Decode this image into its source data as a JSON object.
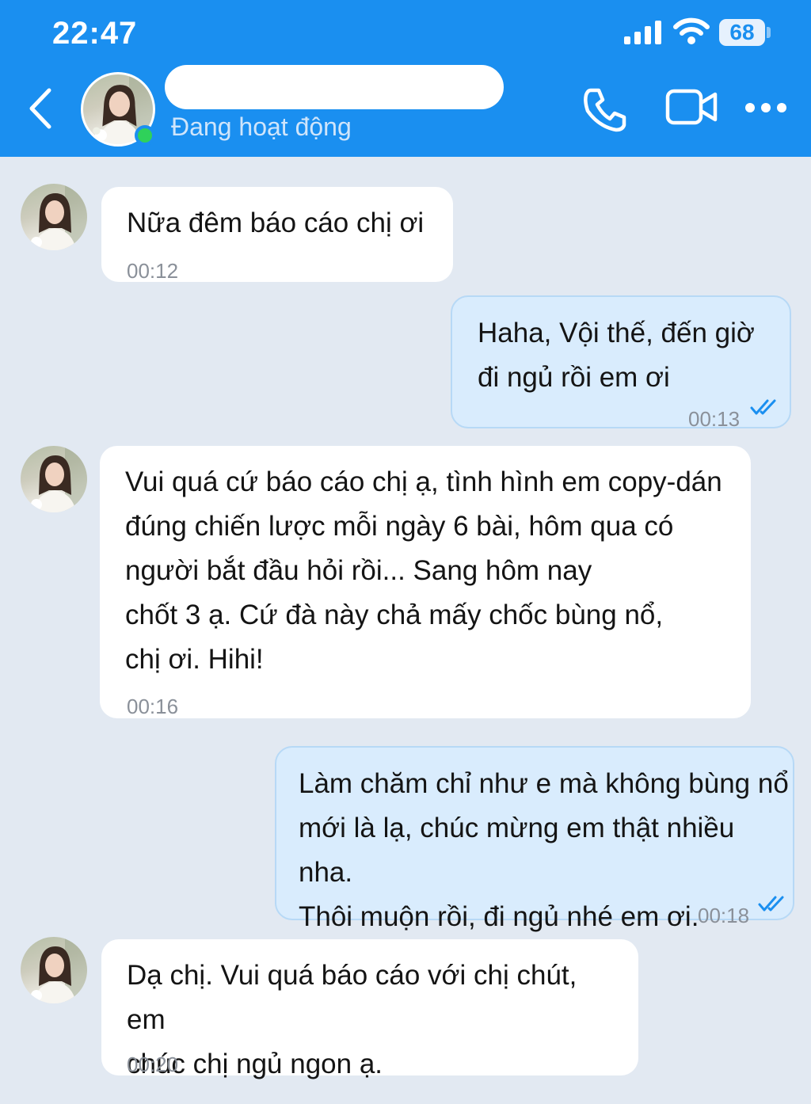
{
  "status_bar": {
    "time": "22:47",
    "battery": "68"
  },
  "header": {
    "contact_name": "",
    "contact_status": "Đang hoạt động",
    "icons": {
      "back": "chevron-left-icon",
      "call": "phone-icon",
      "video": "video-camera-icon",
      "more": "more-dots-icon"
    },
    "online_color": "#2fd15a"
  },
  "colors": {
    "header_bg": "#1a8ff0",
    "chat_bg": "#e2e9f2",
    "incoming_bubble": "#ffffff",
    "outgoing_bubble": "#d9ecfd",
    "read_ticks": "#1a8ff0"
  },
  "messages": [
    {
      "direction": "incoming",
      "text": "Nữa đêm báo cáo chị ơi",
      "time": "00:12"
    },
    {
      "direction": "outgoing",
      "text": "Haha, Vội thế, đến giờ\nđi ngủ rồi em ơi",
      "time": "00:13",
      "status": "read"
    },
    {
      "direction": "incoming",
      "text": "Vui quá cứ báo cáo chị ạ, tình hình em copy-dán\nđúng chiến lược mỗi ngày 6 bài, hôm qua có\nngười bắt đầu hỏi rồi... Sang hôm nay\nchốt 3 ạ. Cứ đà này chả mấy chốc bùng nổ,\nchị ơi. Hihi!",
      "time": "00:16"
    },
    {
      "direction": "outgoing",
      "text": "Làm chăm chỉ như e mà không bùng nổ\nmới là lạ, chúc mừng em thật nhiều nha.\nThôi muộn rồi, đi ngủ nhé em ơi.",
      "time": "00:18",
      "status": "read"
    },
    {
      "direction": "incoming",
      "text": "Dạ chị. Vui quá báo cáo với chị chút, em\nchúc chị ngủ ngon ạ.",
      "time": "00:20"
    }
  ]
}
